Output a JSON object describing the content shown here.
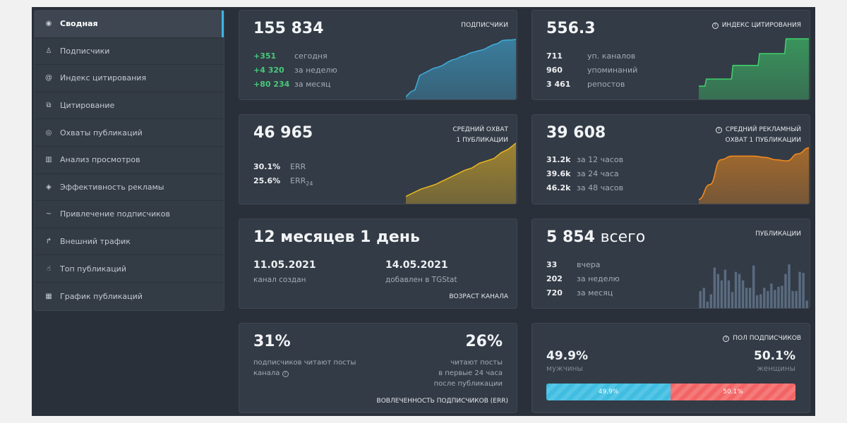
{
  "sidebar": {
    "items": [
      {
        "label": "Сводная",
        "icon": "dashboard-icon",
        "active": true
      },
      {
        "label": "Подписчики",
        "icon": "users-icon"
      },
      {
        "label": "Индекс цитирования",
        "icon": "at-icon"
      },
      {
        "label": "Цитирование",
        "icon": "quote-icon"
      },
      {
        "label": "Охваты публикаций",
        "icon": "eye-icon"
      },
      {
        "label": "Анализ просмотров",
        "icon": "bar-chart-icon"
      },
      {
        "label": "Эффективность рекламы",
        "icon": "tag-icon"
      },
      {
        "label": "Привлечение подписчиков",
        "icon": "trend-icon"
      },
      {
        "label": "Внешний трафик",
        "icon": "share-icon"
      },
      {
        "label": "Топ публикаций",
        "icon": "thumb-up-icon"
      },
      {
        "label": "График публикаций",
        "icon": "calendar-icon"
      }
    ]
  },
  "subscribers": {
    "value": "155 834",
    "title": "ПОДПИСЧИКИ",
    "stats": [
      {
        "v": "+351",
        "l": "сегодня"
      },
      {
        "v": "+4 320",
        "l": "за неделю"
      },
      {
        "v": "+80 234",
        "l": "за месяц"
      }
    ],
    "color": "#3fa9d6",
    "spark": [
      0.02,
      0.1,
      0.14,
      0.38,
      0.42,
      0.46,
      0.5,
      0.52,
      0.55,
      0.6,
      0.64,
      0.66,
      0.7,
      0.72,
      0.76,
      0.78,
      0.8,
      0.82,
      0.86,
      0.9,
      0.92,
      0.97,
      0.98,
      0.98,
      0.99
    ]
  },
  "citation": {
    "value": "556.3",
    "title": "ИНДЕКС ЦИТИРОВАНИЯ",
    "stats": [
      {
        "v": "711",
        "l": "уп. каналов"
      },
      {
        "v": "960",
        "l": "упоминаний"
      },
      {
        "v": "3 461",
        "l": "репостов"
      }
    ],
    "color": "#3fcf6a",
    "spark": [
      0.2,
      0.2,
      0.32,
      0.32,
      0.32,
      0.32,
      0.32,
      0.32,
      0.32,
      0.55,
      0.55,
      0.55,
      0.55,
      0.55,
      0.55,
      0.55,
      0.75,
      0.75,
      0.75,
      0.75,
      0.75,
      0.75,
      0.75,
      1,
      1,
      1,
      1,
      1,
      1,
      1
    ]
  },
  "reach": {
    "value": "46 965",
    "title": [
      "СРЕДНИЙ ОХВАТ",
      "1 ПУБЛИКАЦИИ"
    ],
    "stats": [
      {
        "v": "30.1%",
        "l": "ERR"
      },
      {
        "v": "25.6%",
        "l": "ERR",
        "sub": "24"
      }
    ],
    "color": "#e6b422",
    "spark": [
      0.1,
      0.16,
      0.22,
      0.26,
      0.3,
      0.36,
      0.42,
      0.48,
      0.54,
      0.58,
      0.66,
      0.7,
      0.74,
      0.84,
      0.9,
      1
    ]
  },
  "ad_reach": {
    "value": "39 608",
    "title": [
      "СРЕДНИЙ РЕКЛАМНЫЙ",
      "ОХВАТ 1 ПУБЛИКАЦИИ"
    ],
    "stats": [
      {
        "v": "31.2k",
        "l": "за 12 часов"
      },
      {
        "v": "39.6k",
        "l": "за 24 часа"
      },
      {
        "v": "46.2k",
        "l": "за 48 часов"
      }
    ],
    "color": "#f08a1c",
    "spark": [
      0.05,
      0.3,
      0.72,
      0.78,
      0.78,
      0.78,
      0.76,
      0.72,
      0.7,
      0.82,
      0.92
    ]
  },
  "age": {
    "value": "12 месяцев 1 день",
    "created_date": "11.05.2021",
    "created_label": "канал создан",
    "added_date": "14.05.2021",
    "added_label": "добавлен в TGStat",
    "title": "ВОЗРАСТ КАНАЛА"
  },
  "publications": {
    "total": "5 854",
    "total_suffix": "всего",
    "title": "ПУБЛИКАЦИИ",
    "stats": [
      {
        "v": "33",
        "l": "вчера"
      },
      {
        "v": "202",
        "l": "за неделю"
      },
      {
        "v": "720",
        "l": "за месяц"
      }
    ],
    "bars": [
      16,
      19,
      6,
      13,
      38,
      32,
      26,
      36,
      26,
      15,
      34,
      32,
      26,
      19,
      19,
      40,
      12,
      13,
      19,
      16,
      23,
      17,
      20,
      21,
      32,
      41,
      16,
      16,
      34,
      33,
      7
    ]
  },
  "err": {
    "left_value": "31%",
    "left_desc": [
      "подписчиков читают посты",
      "канала"
    ],
    "right_value": "26%",
    "right_desc": [
      "читают посты",
      "в первые 24 часа",
      "после публикации"
    ],
    "title": "ВОВЛЕЧЕННОСТЬ ПОДПИСЧИКОВ (ERR)"
  },
  "gender": {
    "title": "ПОЛ ПОДПИСЧИКОВ",
    "male_pct": "49.9%",
    "male_label": "мужчины",
    "female_pct": "50.1%",
    "female_label": "женщины",
    "male_fraction": 0.499,
    "male_color": "#40bde0",
    "female_color": "#f26565"
  }
}
